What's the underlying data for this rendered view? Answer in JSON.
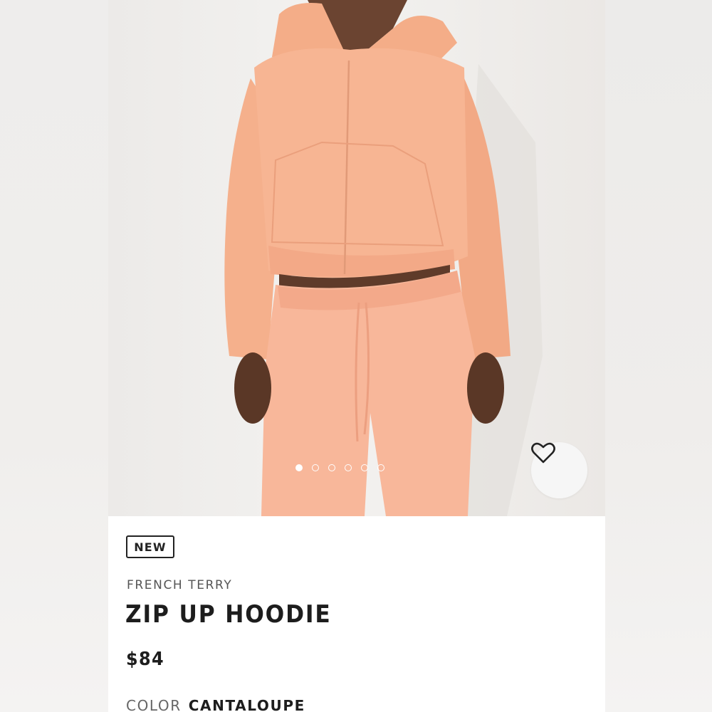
{
  "product": {
    "badge": "NEW",
    "subtitle": "FRENCH TERRY",
    "title": "ZIP UP HOODIE",
    "price": "$84",
    "color_label": "COLOR",
    "color_value": "CANTALOUPE",
    "garment_color": "#f7b593"
  },
  "gallery": {
    "image_count": 6,
    "active_index": 1,
    "favorite_icon": "heart-icon"
  }
}
